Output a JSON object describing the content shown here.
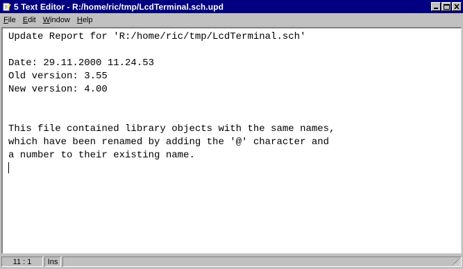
{
  "window": {
    "title": "5 Text Editor - R:/home/ric/tmp/LcdTerminal.sch.upd",
    "app_icon": "text-editor-icon"
  },
  "menu": {
    "file": "File",
    "edit": "Edit",
    "window": "Window",
    "help": "Help"
  },
  "editor": {
    "content": "Update Report for 'R:/home/ric/tmp/LcdTerminal.sch'\n\nDate: 29.11.2000 11.24.53\nOld version: 3.55\nNew version: 4.00\n\n\nThis file contained library objects with the same names,\nwhich have been renamed by adding the '@' character and\na number to their existing name.\n"
  },
  "status": {
    "position": "11 : 1",
    "mode": "Ins",
    "message": ""
  },
  "colors": {
    "titlebar": "#000080",
    "face": "#c0c0c0",
    "editor_bg": "#ffffff"
  }
}
